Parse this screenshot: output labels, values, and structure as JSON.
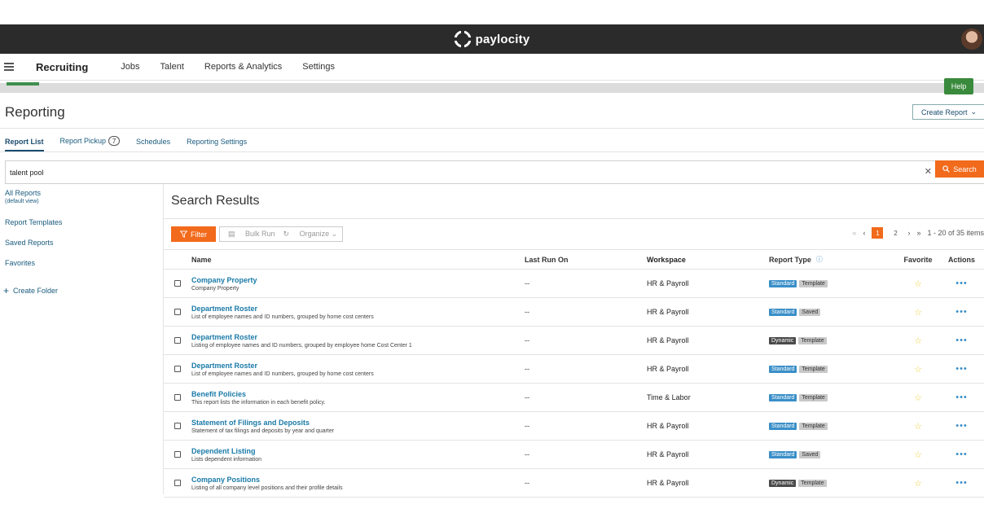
{
  "brand": {
    "name": "paylocity"
  },
  "nav": {
    "title": "Recruiting",
    "items": [
      "Jobs",
      "Talent",
      "Reports & Analytics",
      "Settings"
    ]
  },
  "help_label": "Help",
  "page": {
    "title": "Reporting",
    "create_report_label": "Create Report"
  },
  "tabs": [
    {
      "label": "Report List",
      "active": true
    },
    {
      "label": "Report Pickup",
      "badge": "7"
    },
    {
      "label": "Schedules"
    },
    {
      "label": "Reporting Settings"
    }
  ],
  "search": {
    "value": "talent pool",
    "button_label": "Search"
  },
  "sidebar": {
    "all_reports": "All Reports",
    "default_view": "(default view)",
    "report_templates": "Report Templates",
    "saved_reports": "Saved Reports",
    "favorites": "Favorites",
    "create_folder": "Create Folder"
  },
  "results": {
    "title": "Search Results",
    "filter_label": "Filter",
    "bulk_run_label": "Bulk Run",
    "organize_label": "Organize",
    "pager": {
      "pages": [
        "1",
        "2"
      ],
      "current": "1",
      "summary": "1 - 20 of 35 items"
    },
    "columns": {
      "name": "Name",
      "last_run": "Last Run On",
      "workspace": "Workspace",
      "report_type": "Report Type",
      "favorite": "Favorite",
      "actions": "Actions"
    },
    "rows": [
      {
        "name": "Company Property",
        "desc": "Company Property",
        "last_run": "--",
        "workspace": "HR & Payroll",
        "type": "Standard",
        "kind": "Template"
      },
      {
        "name": "Department Roster",
        "desc": "List of employee names and ID numbers, grouped by home cost centers",
        "last_run": "--",
        "workspace": "HR & Payroll",
        "type": "Standard",
        "kind": "Saved"
      },
      {
        "name": "Department Roster",
        "desc": "Listing of employee names and ID numbers, grouped by employee home Cost Center 1",
        "last_run": "--",
        "workspace": "HR & Payroll",
        "type": "Dynamic",
        "kind": "Template"
      },
      {
        "name": "Department Roster",
        "desc": "List of employee names and ID numbers, grouped by home cost centers",
        "last_run": "--",
        "workspace": "HR & Payroll",
        "type": "Standard",
        "kind": "Template"
      },
      {
        "name": "Benefit Policies",
        "desc": "This report lists the information in each benefit policy.",
        "last_run": "--",
        "workspace": "Time & Labor",
        "type": "Standard",
        "kind": "Template"
      },
      {
        "name": "Statement of Filings and Deposits",
        "desc": "Statement of tax filings and deposits by year and quarter",
        "last_run": "--",
        "workspace": "HR & Payroll",
        "type": "Standard",
        "kind": "Template"
      },
      {
        "name": "Dependent Listing",
        "desc": "Lists dependent information",
        "last_run": "--",
        "workspace": "HR & Payroll",
        "type": "Standard",
        "kind": "Saved"
      },
      {
        "name": "Company Positions",
        "desc": "Listing of all company level positions and their profile details",
        "last_run": "--",
        "workspace": "HR & Payroll",
        "type": "Dynamic",
        "kind": "Template"
      }
    ]
  },
  "colors": {
    "brand_bar": "#2b2b2b",
    "accent_orange": "#f26a1b",
    "link_blue": "#1a7aa8",
    "standard_tag": "#3a8fc8",
    "dynamic_tag": "#4a4a4a",
    "help_green": "#3a8a3d"
  }
}
